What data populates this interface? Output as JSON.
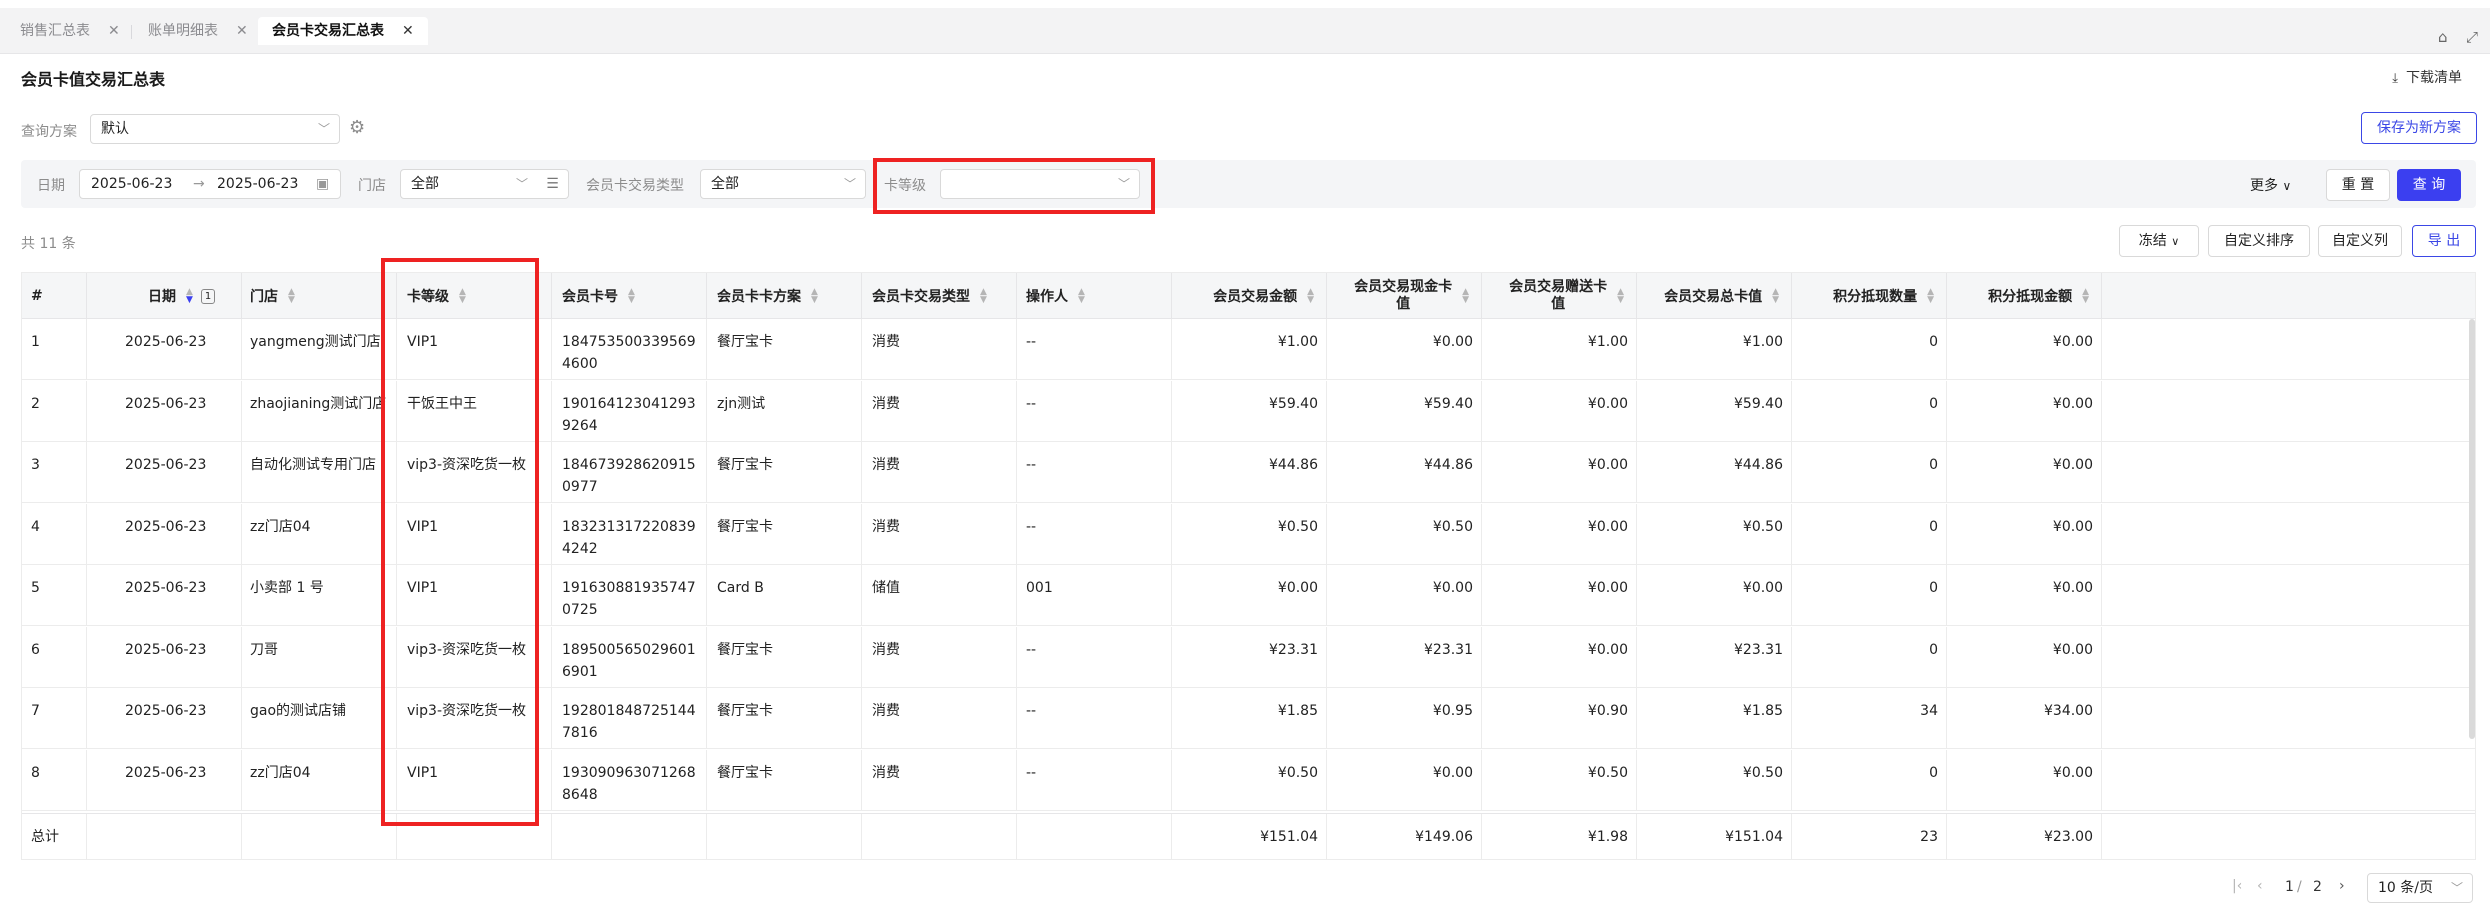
{
  "tabs": [
    {
      "label": "销售汇总表"
    },
    {
      "label": "账单明细表"
    },
    {
      "label": "会员卡交易汇总表"
    }
  ],
  "page": {
    "title": "会员卡值交易汇总表",
    "download_label": "下载清单"
  },
  "query": {
    "scheme_label": "查询方案",
    "scheme_value": "默认",
    "save_label": "保存为新方案"
  },
  "filters": {
    "date_label": "日期",
    "date_start": "2025-06-23",
    "date_sep": "→",
    "date_end": "2025-06-23",
    "store_label": "门店",
    "store_value": "全部",
    "type_label": "会员卡交易类型",
    "type_value": "全部",
    "level_label": "卡等级",
    "level_value": "",
    "more_label": "更多",
    "reset_label": "重 置",
    "search_label": "查 询"
  },
  "toolbar": {
    "count_text": "共 11 条",
    "freeze_label": "冻结",
    "custom_sort_label": "自定义排序",
    "custom_cols_label": "自定义列",
    "export_label": "导 出"
  },
  "table": {
    "headers": {
      "idx": "#",
      "date": "日期",
      "date_badge": "1",
      "store": "门店",
      "level": "卡等级",
      "card_no": "会员卡号",
      "plan": "会员卡卡方案",
      "tx_type": "会员卡交易类型",
      "operator": "操作人",
      "amount": "会员交易金额",
      "cash_1": "会员交易现金卡",
      "cash_2": "值",
      "gift_1": "会员交易赠送卡",
      "gift_2": "值",
      "total": "会员交易总卡值",
      "points": "积分抵现数量",
      "points_amt": "积分抵现金额"
    },
    "rows": [
      {
        "idx": "1",
        "date": "2025-06-23",
        "store": "yangmeng测试门店",
        "level": "VIP1",
        "card_no": "1847535003395694600",
        "plan": "餐厅宝卡",
        "tx_type": "消费",
        "operator": "--",
        "amount": "¥1.00",
        "cash": "¥0.00",
        "gift": "¥1.00",
        "total": "¥1.00",
        "points": "0",
        "points_amt": "¥0.00"
      },
      {
        "idx": "2",
        "date": "2025-06-23",
        "store": "zhaojianing测试门店",
        "level": "干饭王中王",
        "card_no": "1901641230412939264",
        "plan": "zjn测试",
        "tx_type": "消费",
        "operator": "--",
        "amount": "¥59.40",
        "cash": "¥59.40",
        "gift": "¥0.00",
        "total": "¥59.40",
        "points": "0",
        "points_amt": "¥0.00"
      },
      {
        "idx": "3",
        "date": "2025-06-23",
        "store": "自动化测试专用门店",
        "level": "vip3-资深吃货一枚",
        "card_no": "1846739286209150977",
        "plan": "餐厅宝卡",
        "tx_type": "消费",
        "operator": "--",
        "amount": "¥44.86",
        "cash": "¥44.86",
        "gift": "¥0.00",
        "total": "¥44.86",
        "points": "0",
        "points_amt": "¥0.00"
      },
      {
        "idx": "4",
        "date": "2025-06-23",
        "store": "zz门店04",
        "level": "VIP1",
        "card_no": "1832313172208394242",
        "plan": "餐厅宝卡",
        "tx_type": "消费",
        "operator": "--",
        "amount": "¥0.50",
        "cash": "¥0.50",
        "gift": "¥0.00",
        "total": "¥0.50",
        "points": "0",
        "points_amt": "¥0.00"
      },
      {
        "idx": "5",
        "date": "2025-06-23",
        "store": "小卖部 1 号",
        "level": "VIP1",
        "card_no": "1916308819357470725",
        "plan": "Card B",
        "tx_type": "储值",
        "operator": "001",
        "amount": "¥0.00",
        "cash": "¥0.00",
        "gift": "¥0.00",
        "total": "¥0.00",
        "points": "0",
        "points_amt": "¥0.00"
      },
      {
        "idx": "6",
        "date": "2025-06-23",
        "store": "刀哥",
        "level": "vip3-资深吃货一枚",
        "card_no": "1895005650296016901",
        "plan": "餐厅宝卡",
        "tx_type": "消费",
        "operator": "--",
        "amount": "¥23.31",
        "cash": "¥23.31",
        "gift": "¥0.00",
        "total": "¥23.31",
        "points": "0",
        "points_amt": "¥0.00"
      },
      {
        "idx": "7",
        "date": "2025-06-23",
        "store": "gao的测试店铺",
        "level": "vip3-资深吃货一枚",
        "card_no": "1928018487251447816",
        "plan": "餐厅宝卡",
        "tx_type": "消费",
        "operator": "--",
        "amount": "¥1.85",
        "cash": "¥0.95",
        "gift": "¥0.90",
        "total": "¥1.85",
        "points": "34",
        "points_amt": "¥34.00"
      },
      {
        "idx": "8",
        "date": "2025-06-23",
        "store": "zz门店04",
        "level": "VIP1",
        "card_no": "1930909630712688648",
        "plan": "餐厅宝卡",
        "tx_type": "消费",
        "operator": "--",
        "amount": "¥0.50",
        "cash": "¥0.00",
        "gift": "¥0.50",
        "total": "¥0.50",
        "points": "0",
        "points_amt": "¥0.00"
      }
    ],
    "total": {
      "label": "总计",
      "amount": "¥151.04",
      "cash": "¥149.06",
      "gift": "¥1.98",
      "total": "¥151.04",
      "points": "23",
      "points_amt": "¥23.00"
    }
  },
  "pagination": {
    "current": "1",
    "sep": "/",
    "pages": "2",
    "page_size": "10 条/页"
  },
  "colors": {
    "accent": "#3b3ff0",
    "highlight": "#ee2222"
  }
}
